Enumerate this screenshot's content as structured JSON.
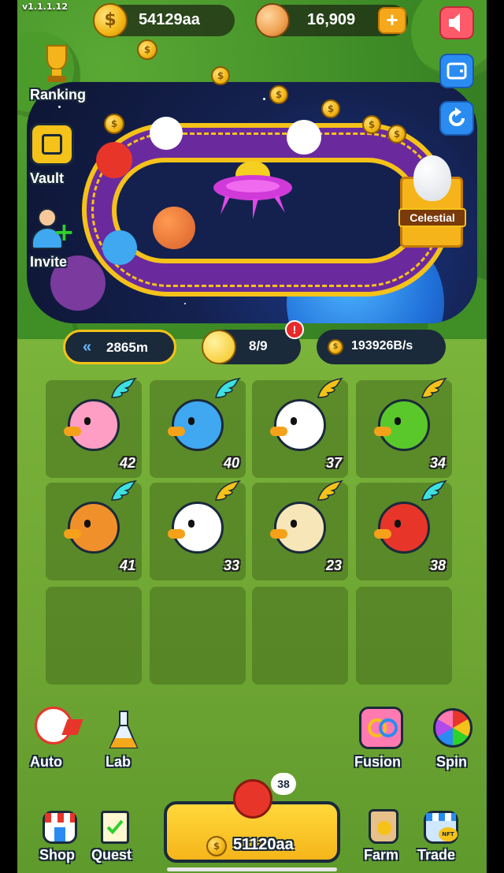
{
  "version": "v1.1.1.12",
  "header": {
    "coins": "54129aa",
    "gems": "16,909",
    "add_symbol": "+"
  },
  "side_menu": {
    "ranking": "Ranking",
    "vault": "Vault",
    "invite": "Invite"
  },
  "race": {
    "badge": "Celestial"
  },
  "stats": {
    "distance": "2865m",
    "distance_icon": "«",
    "slots": "8/9",
    "alert_symbol": "!",
    "income": "193926B/s"
  },
  "grid": {
    "cells": [
      {
        "animal": "pink-sheep",
        "level": "42",
        "wing": "cyan"
      },
      {
        "animal": "blue-bird",
        "level": "40",
        "wing": "cyan"
      },
      {
        "animal": "white-pig",
        "level": "37",
        "wing": "gold"
      },
      {
        "animal": "green-chicken",
        "level": "34",
        "wing": "gold"
      },
      {
        "animal": "orange-pig",
        "level": "41",
        "wing": "cyan"
      },
      {
        "animal": "white-bunny",
        "level": "33",
        "wing": "gold"
      },
      {
        "animal": "cream-sheep",
        "level": "23",
        "wing": "gold"
      },
      {
        "animal": "red-chicken",
        "level": "38",
        "wing": "cyan"
      }
    ]
  },
  "actions": {
    "auto": "Auto",
    "lab": "Lab",
    "fusion": "Fusion",
    "spin": "Spin"
  },
  "buy": {
    "level": "38",
    "price": "51120aa"
  },
  "nav": {
    "shop": "Shop",
    "quest": "Quest",
    "farm": "Farm",
    "trade": "Trade",
    "nft_tag": "NFT"
  },
  "colors": {
    "gold": "#f5c21a",
    "track": "#6a2a9e",
    "space": "#14214f",
    "grass": "#6ea533"
  }
}
